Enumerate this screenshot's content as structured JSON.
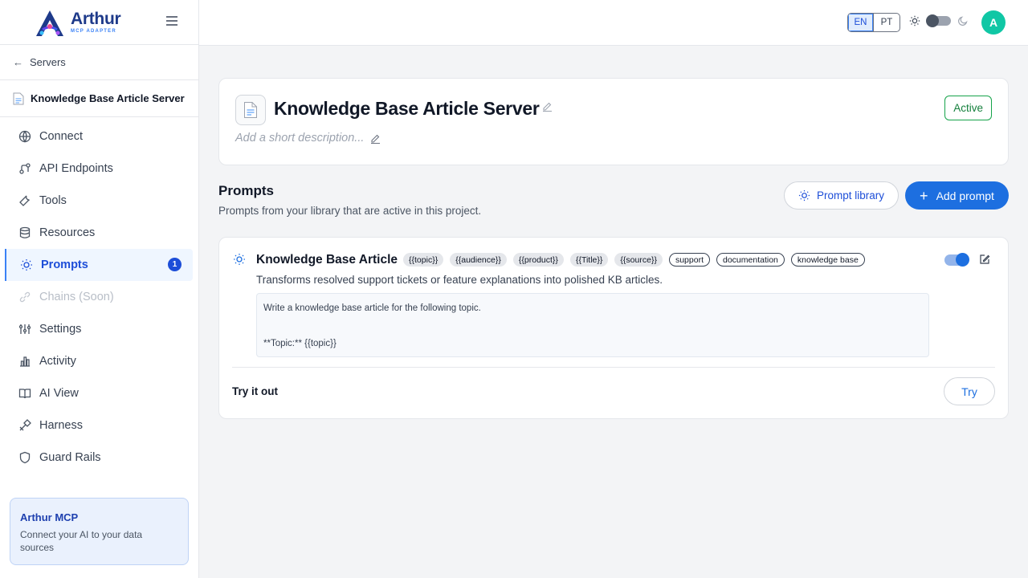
{
  "brand": {
    "name": "Arthur",
    "sub": "MCP ADAPTER"
  },
  "sidebar": {
    "back_label": "Servers",
    "server_name": "Knowledge Base Article Server",
    "items": [
      {
        "label": "Connect",
        "icon": "globe-icon"
      },
      {
        "label": "API Endpoints",
        "icon": "endpoints-icon"
      },
      {
        "label": "Tools",
        "icon": "wrench-icon"
      },
      {
        "label": "Resources",
        "icon": "database-icon"
      },
      {
        "label": "Prompts",
        "icon": "lightbulb-icon",
        "active": true,
        "badge": "1"
      },
      {
        "label": "Chains (Soon)",
        "icon": "link-icon",
        "disabled": true
      },
      {
        "label": "Settings",
        "icon": "sliders-icon"
      },
      {
        "label": "Activity",
        "icon": "bar-chart-icon"
      },
      {
        "label": "AI View",
        "icon": "book-icon"
      },
      {
        "label": "Harness",
        "icon": "harness-icon"
      },
      {
        "label": "Guard Rails",
        "icon": "shield-icon"
      }
    ],
    "promo": {
      "title": "Arthur MCP",
      "text": "Connect your AI to your data sources"
    }
  },
  "topbar": {
    "lang_en": "EN",
    "lang_pt": "PT",
    "avatar_initial": "A"
  },
  "server": {
    "title": "Knowledge Base Article Server",
    "description_placeholder": "Add a short description...",
    "status": "Active"
  },
  "prompts_section": {
    "title": "Prompts",
    "subtitle": "Prompts from your library that are active in this project.",
    "library_button": "Prompt library",
    "add_button": "Add prompt"
  },
  "prompt": {
    "title": "Knowledge Base Article",
    "variables": [
      "{{topic}}",
      "{{audience}}",
      "{{product}}",
      "{{Title}}",
      "{{source}}"
    ],
    "keywords": [
      "support",
      "documentation",
      "knowledge base"
    ],
    "description": "Transforms resolved support tickets or feature explanations into polished KB articles.",
    "body_line1": "Write a knowledge base article for the following topic.",
    "body_line2": "**Topic:** {{topic}}",
    "enabled": true,
    "try_label": "Try it out",
    "try_button": "Try"
  },
  "colors": {
    "accent": "#1d6fe0",
    "active_green": "#15803d",
    "avatar": "#10c7a5"
  }
}
